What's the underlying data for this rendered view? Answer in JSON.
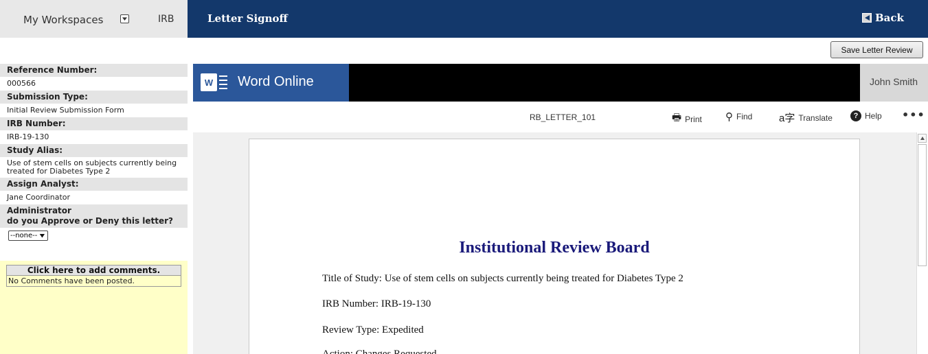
{
  "nav": {
    "workspaces_label": "My Workspaces",
    "irb_tab": "IRB",
    "page_title": "Letter Signoff",
    "back_label": "Back"
  },
  "actions": {
    "save_label": "Save Letter Review"
  },
  "sidebar": {
    "reference_label": "Reference Number:",
    "reference_value": "000566",
    "submission_type_label": "Submission Type:",
    "submission_type_value": "Initial Review Submission Form",
    "irb_number_label": "IRB Number:",
    "irb_number_value": "IRB-19-130",
    "study_alias_label": "Study Alias:",
    "study_alias_value": "Use of stem cells on subjects currently being treated for Diabetes Type 2",
    "analyst_label": "Assign Analyst:",
    "analyst_value": "Jane Coordinator",
    "admin_label_line1": "Administrator",
    "admin_label_line2": "do you Approve or Deny this letter?",
    "decision_selected": "--none--",
    "comments_header": "Click here to add comments.",
    "comments_body": "No Comments have been posted."
  },
  "word": {
    "app_name": "Word Online",
    "logo_letter": "W",
    "user_name": "John Smith",
    "document_name": "RB_LETTER_101",
    "toolbar": {
      "print": "Print",
      "find": "Find",
      "translate": "Translate",
      "help": "Help",
      "more": "•••"
    }
  },
  "document": {
    "heading": "Institutional Review Board",
    "title_line": "Title  of  Study: Use  of  stem  cells  on  subjects  currently  being  treated  for  Diabetes  Type  2",
    "irb_line": "IRB  Number:  IRB-19-130",
    "review_line": "Review  Type: Expedited",
    "action_line": "Action:  Changes  Requested"
  },
  "colors": {
    "top_bar": "#13386b",
    "word_brand": "#2b579a",
    "comments_bg": "#ffffc8",
    "heading": "#1a1a7a"
  }
}
